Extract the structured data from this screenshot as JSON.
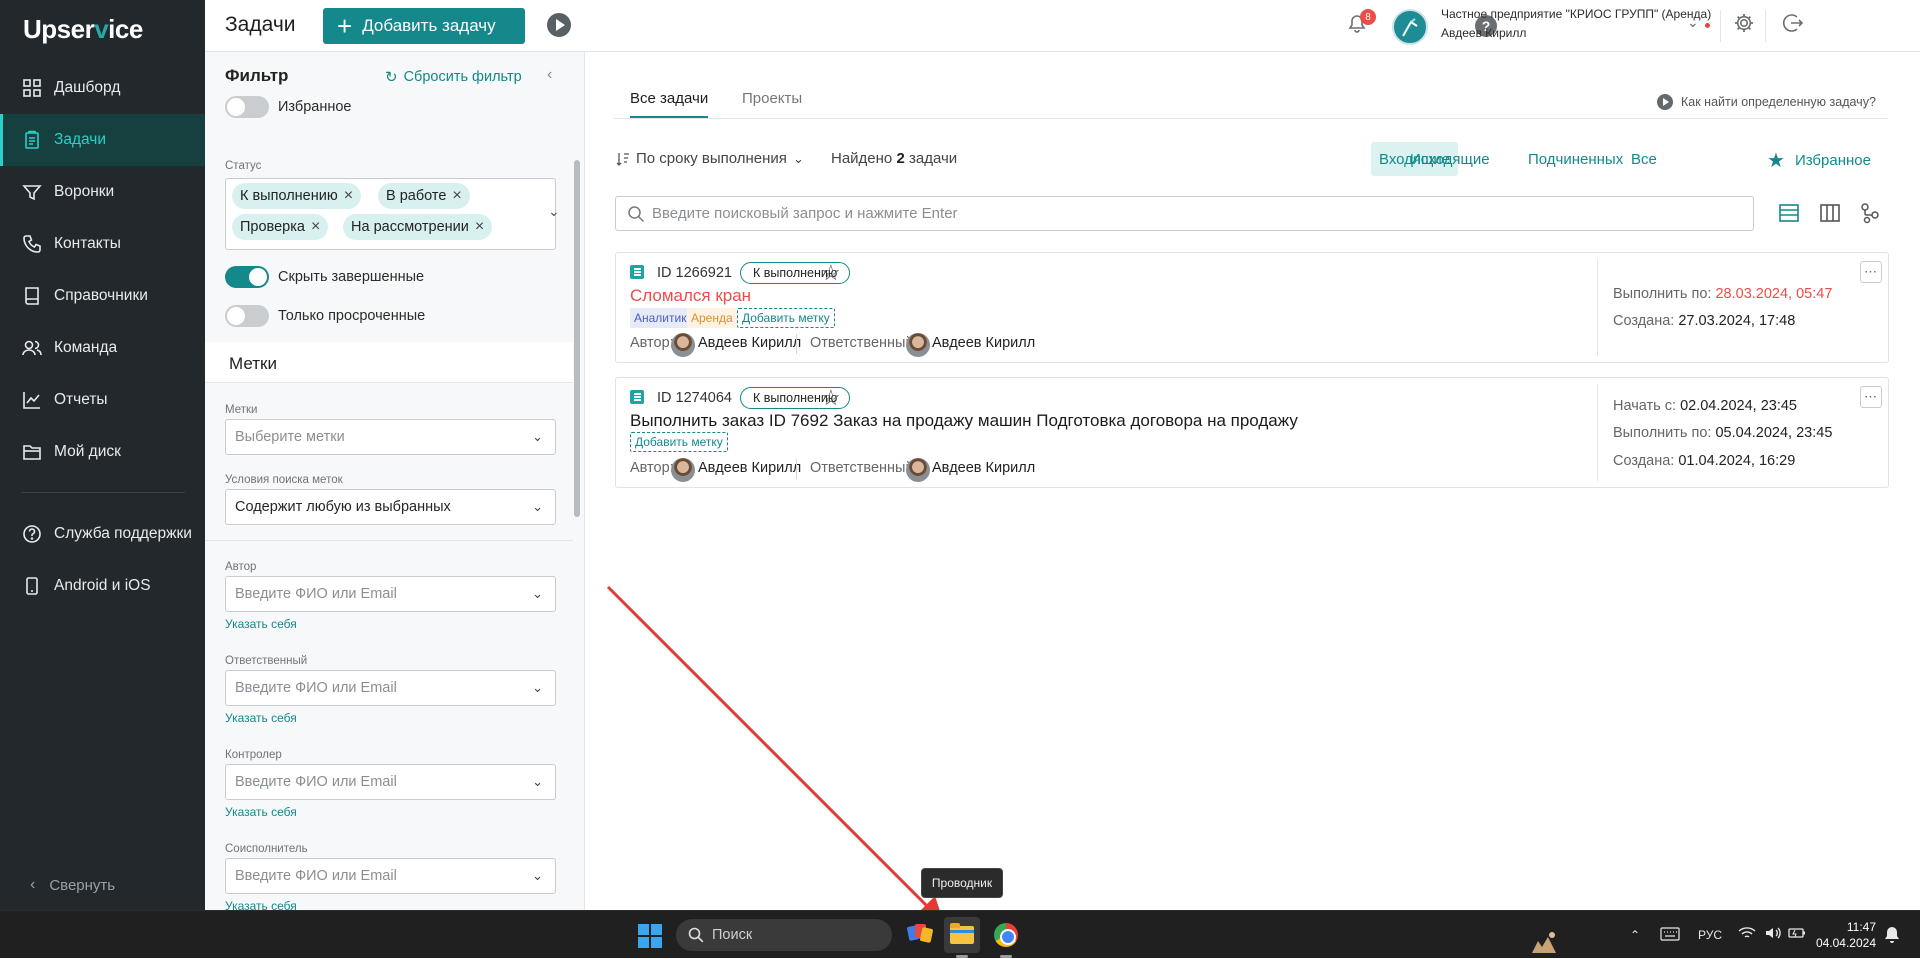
{
  "app": {
    "logo_a": "Upser",
    "logo_v": "v",
    "logo_b": "ice"
  },
  "sidebar": {
    "items": [
      {
        "label": "Дашборд",
        "icon": "dashboard-icon"
      },
      {
        "label": "Задачи",
        "icon": "tasks-icon",
        "active": true
      },
      {
        "label": "Воронки",
        "icon": "funnel-icon"
      },
      {
        "label": "Контакты",
        "icon": "phone-icon"
      },
      {
        "label": "Справочники",
        "icon": "book-icon"
      },
      {
        "label": "Команда",
        "icon": "team-icon"
      },
      {
        "label": "Отчеты",
        "icon": "chart-icon"
      },
      {
        "label": "Мой диск",
        "icon": "folder-icon"
      },
      {
        "label": "Служба поддержки",
        "icon": "help-icon"
      },
      {
        "label": "Android и iOS",
        "icon": "mobile-icon"
      }
    ],
    "collapse_label": "Свернуть"
  },
  "header": {
    "title": "Задачи",
    "add_label": "Добавить задачу",
    "notifications": "8",
    "org": "Частное предприятие \"КРИОС ГРУПП\" (Аренда)",
    "user": "Авдеев Кирилл"
  },
  "filter": {
    "title": "Фильтр",
    "reset": "Сбросить фильтр",
    "favorites": "Избранное",
    "status_label": "Статус",
    "statuses": [
      "К выполнению",
      "В работе",
      "Проверка",
      "На рассмотрении"
    ],
    "hide_done": "Скрыть завершенные",
    "only_overdue": "Только просроченные",
    "labels_title": "Метки",
    "labels_label": "Метки",
    "labels_placeholder": "Выберите метки",
    "labels_cond_label": "Условия поиска меток",
    "labels_cond_value": "Содержит любую из выбранных",
    "author_label": "Автор",
    "responsible_label": "Ответственный",
    "controller_label": "Контролер",
    "coexec_label": "Соисполнитель",
    "person_placeholder": "Введите ФИО или Email",
    "self_link": "Указать себя"
  },
  "main": {
    "tabs": [
      "Все задачи",
      "Проекты"
    ],
    "howto": "Как найти определенную задачу?",
    "sort": "По сроку выполнения",
    "found_prefix": "Найдено",
    "found_count": "2",
    "found_suffix": "задачи",
    "segments": [
      "Входящие",
      "Исходящие",
      "Подчиненных",
      "Все"
    ],
    "fav": "Избранное",
    "search_placeholder": "Введите поисковый запрос и нажмите Enter",
    "author_label": "Автор:",
    "responsible_label": "Ответственный:",
    "add_tag": "Добавить метку",
    "tasks": [
      {
        "id": "ID 1266921",
        "status": "К выполнению",
        "title": "Сломался кран",
        "tags": [
          "Аналитик",
          "Аренда"
        ],
        "author": "Авдеев Кирилл",
        "responsible": "Авдеев Кирилл",
        "due_label": "Выполнить по:",
        "due": "28.03.2024, 05:47",
        "created_label": "Создана:",
        "created": "27.03.2024, 17:48"
      },
      {
        "id": "ID 1274064",
        "status": "К выполнению",
        "title": "Выполнить заказ ID 7692 Заказ на продажу машин Подготовка договора на продажу",
        "author": "Авдеев Кирилл",
        "responsible": "Авдеев Кирилл",
        "start_label": "Начать с:",
        "start": "02.04.2024, 23:45",
        "due_label": "Выполнить по:",
        "due": "05.04.2024, 23:45",
        "created_label": "Создана:",
        "created": "01.04.2024, 16:29"
      }
    ]
  },
  "tooltip": "Проводник",
  "taskbar": {
    "search": "Поиск",
    "lang": "РУС",
    "time": "11:47",
    "date": "04.04.2024"
  },
  "colors": {
    "accent": "#14888a",
    "sidebar": "#23282c",
    "danger": "#ee4c48",
    "arrow": "#e53935"
  }
}
